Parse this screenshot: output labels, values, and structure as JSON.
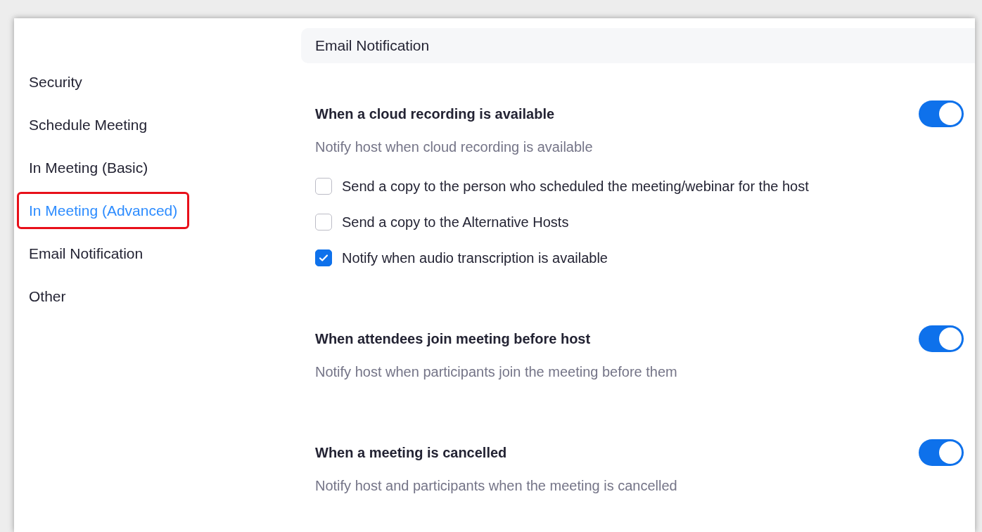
{
  "sidebar": {
    "items": [
      {
        "label": "Security",
        "selected": false,
        "annotated": false
      },
      {
        "label": "Schedule Meeting",
        "selected": false,
        "annotated": false
      },
      {
        "label": "In Meeting (Basic)",
        "selected": false,
        "annotated": false
      },
      {
        "label": "In Meeting (Advanced)",
        "selected": true,
        "annotated": true
      },
      {
        "label": "Email Notification",
        "selected": false,
        "annotated": false
      },
      {
        "label": "Other",
        "selected": false,
        "annotated": false
      }
    ]
  },
  "section_header": {
    "title": "Email Notification"
  },
  "settings": [
    {
      "title": "When a cloud recording is available",
      "description": "Notify host when cloud recording is available",
      "on": true,
      "options": [
        {
          "label": "Send a copy to the person who scheduled the meeting/webinar for the host",
          "checked": false
        },
        {
          "label": "Send a copy to the Alternative Hosts",
          "checked": false
        },
        {
          "label": "Notify when audio transcription is available",
          "checked": true
        }
      ]
    },
    {
      "title": "When attendees join meeting before host",
      "description": "Notify host when participants join the meeting before them",
      "on": true
    },
    {
      "title": "When a meeting is cancelled",
      "description": "Notify host and participants when the meeting is cancelled",
      "on": true
    }
  ]
}
